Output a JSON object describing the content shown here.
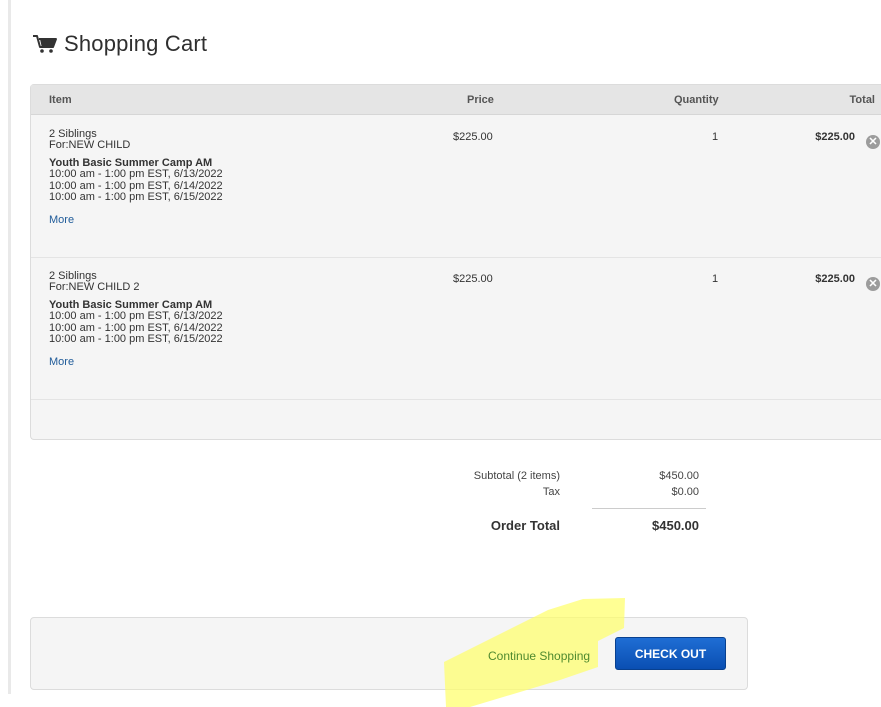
{
  "header": {
    "icon": "shopping-cart-icon",
    "title": "Shopping Cart"
  },
  "table": {
    "columns": [
      "Item",
      "Price",
      "Quantity",
      "Total"
    ],
    "rows": [
      {
        "item_line1": "2 Siblings",
        "item_line2": "For:NEW CHILD",
        "program": "Youth Basic Summer Camp AM",
        "times": [
          "10:00 am - 1:00 pm EST, 6/13/2022",
          "10:00 am - 1:00 pm EST, 6/14/2022",
          "10:00 am - 1:00 pm EST, 6/15/2022"
        ],
        "more_label": "More",
        "price": "$225.00",
        "quantity": "1",
        "total": "$225.00",
        "remove_icon": "remove-circle-icon"
      },
      {
        "item_line1": "2 Siblings",
        "item_line2": "For:NEW CHILD 2",
        "program": "Youth Basic Summer Camp AM",
        "times": [
          "10:00 am - 1:00 pm EST, 6/13/2022",
          "10:00 am - 1:00 pm EST, 6/14/2022",
          "10:00 am - 1:00 pm EST, 6/15/2022"
        ],
        "more_label": "More",
        "price": "$225.00",
        "quantity": "1",
        "total": "$225.00",
        "remove_icon": "remove-circle-icon"
      }
    ]
  },
  "summary": {
    "subtotal_label": "Subtotal (2 items)",
    "subtotal_value": "$450.00",
    "tax_label": "Tax",
    "tax_value": "$0.00",
    "order_total_label": "Order Total",
    "order_total_value": "$450.00"
  },
  "footer": {
    "continue_label": "Continue Shopping",
    "checkout_label": "CHECK OUT"
  },
  "colors": {
    "link": "#1f5b99",
    "checkout_button": "#0a4fb2",
    "highlight": "#ffff66"
  }
}
